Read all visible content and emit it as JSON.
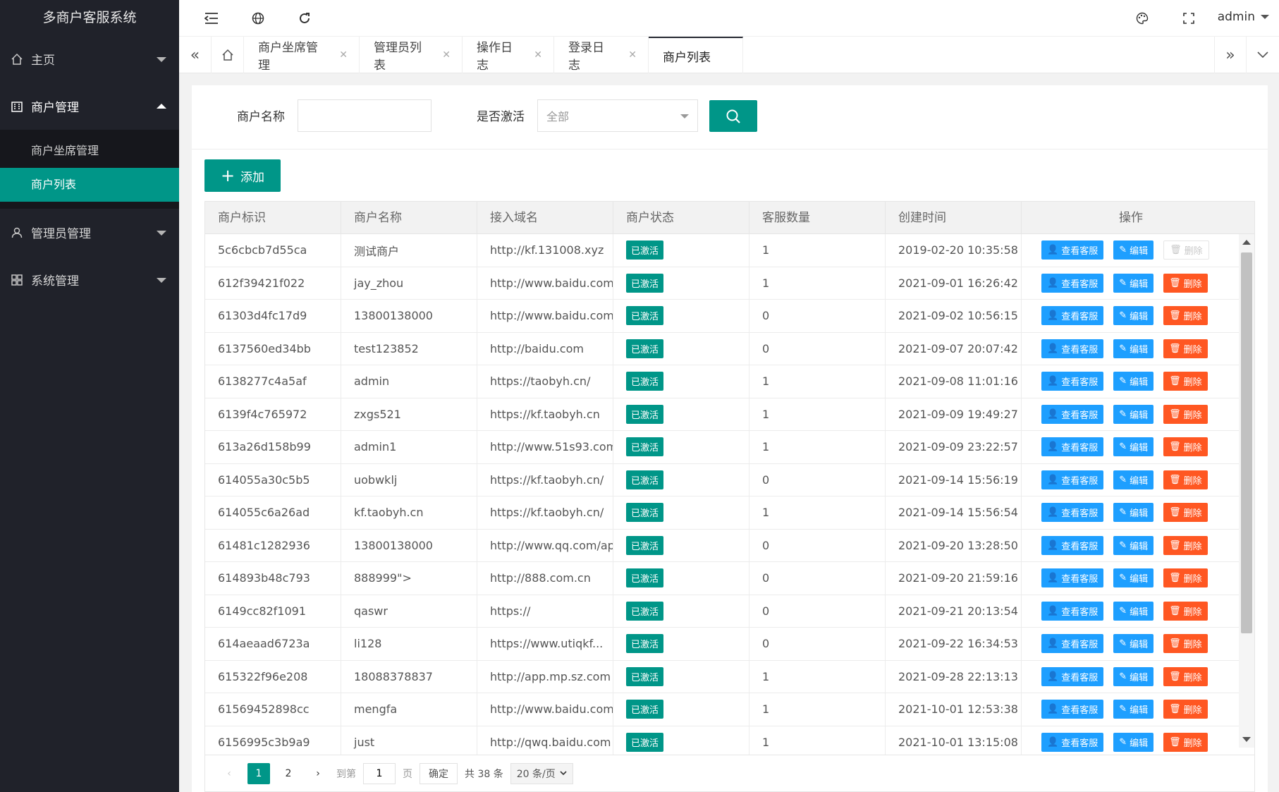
{
  "app_title": "多商户客服系统",
  "sidebar": {
    "items": [
      {
        "label": "主页"
      },
      {
        "label": "商户管理",
        "children": [
          {
            "label": "商户坐席管理"
          },
          {
            "label": "商户列表"
          }
        ]
      },
      {
        "label": "管理员管理"
      },
      {
        "label": "系统管理"
      }
    ]
  },
  "header": {
    "user": "admin"
  },
  "tabs": [
    {
      "label": "商户坐席管理"
    },
    {
      "label": "管理员列表"
    },
    {
      "label": "操作日志"
    },
    {
      "label": "登录日志"
    },
    {
      "label": "商户列表"
    }
  ],
  "filter": {
    "name_label": "商户名称",
    "name_value": "",
    "active_label": "是否激活",
    "active_value": "全部"
  },
  "add_label": "添加",
  "table": {
    "columns": [
      "商户标识",
      "商户名称",
      "接入域名",
      "商户状态",
      "客服数量",
      "创建时间",
      "操作"
    ],
    "rows": [
      [
        "5c6cbcb7d55ca",
        "测试商户",
        "http://kf.131008.xyz",
        "已激活",
        "1",
        "2019-02-20 10:35:58"
      ],
      [
        "612f39421f022",
        "jay_zhou",
        "http://www.baidu.com",
        "已激活",
        "1",
        "2021-09-01 16:26:42"
      ],
      [
        "61303d4fc17d9",
        "13800138000",
        "http://www.baidu.com",
        "已激活",
        "0",
        "2021-09-02 10:56:15"
      ],
      [
        "6137560ed34bb",
        "test123852",
        "http://baidu.com",
        "已激活",
        "0",
        "2021-09-07 20:07:42"
      ],
      [
        "6138277c4a5af",
        "admin",
        "https://taobyh.cn/",
        "已激活",
        "1",
        "2021-09-08 11:01:16"
      ],
      [
        "6139f4c765972",
        "zxgs521",
        "https://kf.taobyh.cn",
        "已激活",
        "1",
        "2021-09-09 19:49:27"
      ],
      [
        "613a26d158b99",
        "admin1",
        "http://www.51s93.com",
        "已激活",
        "1",
        "2021-09-09 23:22:57"
      ],
      [
        "614055a30c5b5",
        "uobwklj",
        "https://kf.taobyh.cn/",
        "已激活",
        "0",
        "2021-09-14 15:56:19"
      ],
      [
        "614055c6a26ad",
        "kf.taobyh.cn",
        "https://kf.taobyh.cn/",
        "已激活",
        "1",
        "2021-09-14 15:56:54"
      ],
      [
        "61481c1282936",
        "13800138000",
        "http://www.qq.com/ap...",
        "已激活",
        "0",
        "2021-09-20 13:28:50"
      ],
      [
        "614893b48c793",
        "888999\">",
        "http://888.com.cn",
        "已激活",
        "0",
        "2021-09-20 21:59:16"
      ],
      [
        "6149cc82f1091",
        "qaswr",
        "https://",
        "已激活",
        "0",
        "2021-09-21 20:13:54"
      ],
      [
        "614aeaad6723a",
        "li128",
        "https://www.utiqkf...",
        "已激活",
        "0",
        "2021-09-22 16:34:53"
      ],
      [
        "615322f96e208",
        "18088378837",
        "http://app.mp.sz.com",
        "已激活",
        "1",
        "2021-09-28 22:13:13"
      ],
      [
        "61569452898cc",
        "mengfa",
        "http://www.baidu.com",
        "已激活",
        "1",
        "2021-10-01 12:53:38"
      ],
      [
        "6156995c3b9a9",
        "just",
        "http://qwq.baidu.com",
        "已激活",
        "1",
        "2021-10-01 13:15:08"
      ]
    ],
    "ops": {
      "view": "查看客服",
      "edit": "编辑",
      "del": "删除"
    }
  },
  "pager": {
    "pages": [
      "1",
      "2"
    ],
    "goto_label": "到第",
    "goto_value": "1",
    "page_unit": "页",
    "confirm": "确定",
    "total": "共 38 条",
    "size": "20 条/页"
  }
}
